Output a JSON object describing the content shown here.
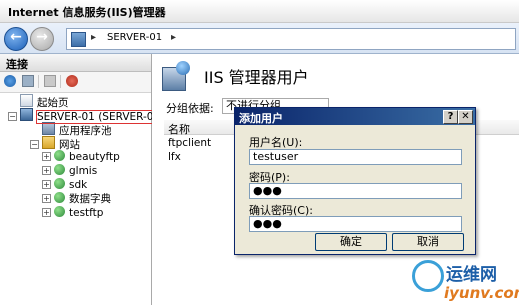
{
  "window": {
    "title": "Internet 信息服务(IIS)管理器"
  },
  "address": {
    "separator": "▸",
    "path": "SERVER-01"
  },
  "connections": {
    "header": "连接",
    "tree": [
      {
        "label": "起始页",
        "icon": "start-page-icon"
      },
      {
        "label": "SERVER-01 (SERVER-01",
        "icon": "server-icon",
        "expander": "−"
      },
      {
        "label": "应用程序池",
        "icon": "app-pool-icon"
      },
      {
        "label": "网站",
        "icon": "sites-folder-icon",
        "expander": "−"
      },
      {
        "label": "beautyftp",
        "icon": "globe-icon",
        "expander": "+"
      },
      {
        "label": "glmis",
        "icon": "globe-icon",
        "expander": "+"
      },
      {
        "label": "sdk",
        "icon": "globe-icon",
        "expander": "+"
      },
      {
        "label": "数据字典",
        "icon": "globe-icon",
        "expander": "+"
      },
      {
        "label": "testftp",
        "icon": "globe-icon",
        "expander": "+"
      }
    ]
  },
  "main": {
    "title": "IIS 管理器用户",
    "group_by_label": "分组依据:",
    "group_by_value": "不进行分组",
    "column_name": "名称",
    "users": [
      "ftpclient",
      "lfx"
    ]
  },
  "dialog": {
    "title": "添加用户",
    "help_label": "?",
    "close_label": "✕",
    "username_label": "用户名(U):",
    "username_value": "testuser",
    "password_label": "密码(P):",
    "password_value": "●●●",
    "confirm_label": "确认密码(C):",
    "confirm_value": "●●●",
    "ok_label": "确定",
    "cancel_label": "取消"
  },
  "watermark": {
    "text1": "运维网",
    "text2": "iyunv.com"
  }
}
